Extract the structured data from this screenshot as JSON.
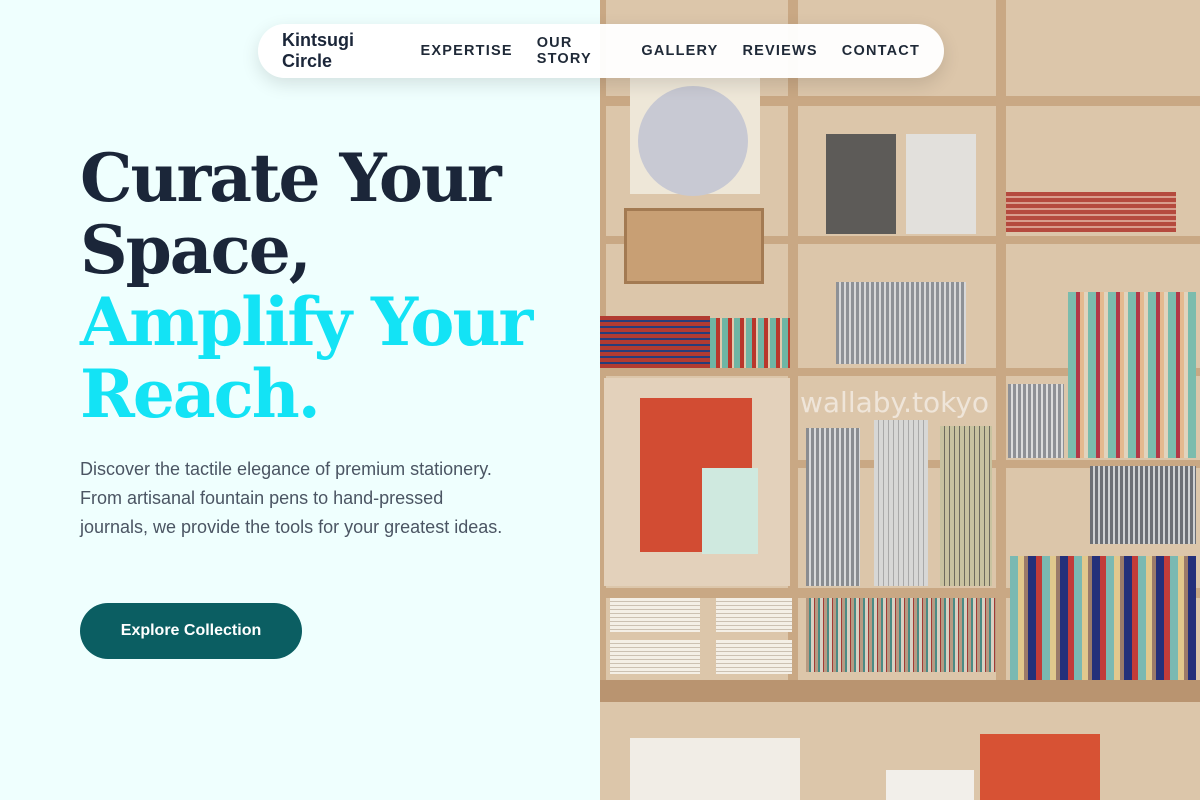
{
  "nav": {
    "brand": "Kintsugi Circle",
    "links": [
      "EXPERTISE",
      "OUR STORY",
      "GALLERY",
      "REVIEWS",
      "CONTACT"
    ]
  },
  "hero": {
    "headline_line1": "Curate Your",
    "headline_line2": "Space,",
    "headline_accent_line1": "Amplify Your",
    "headline_accent_line2": "Reach.",
    "lead": "Discover the tactile elegance of premium stationery. From artisanal fountain pens to hand-pressed journals, we provide the tools for your greatest ideas.",
    "cta_label": "Explore Collection"
  },
  "photo": {
    "watermark": "wallaby.tokyo",
    "subject": "stationery shelves"
  },
  "colors": {
    "headline": "#1b2639",
    "accent": "#13e3f5",
    "cta": "#0b5e62",
    "background": "#effffe"
  }
}
